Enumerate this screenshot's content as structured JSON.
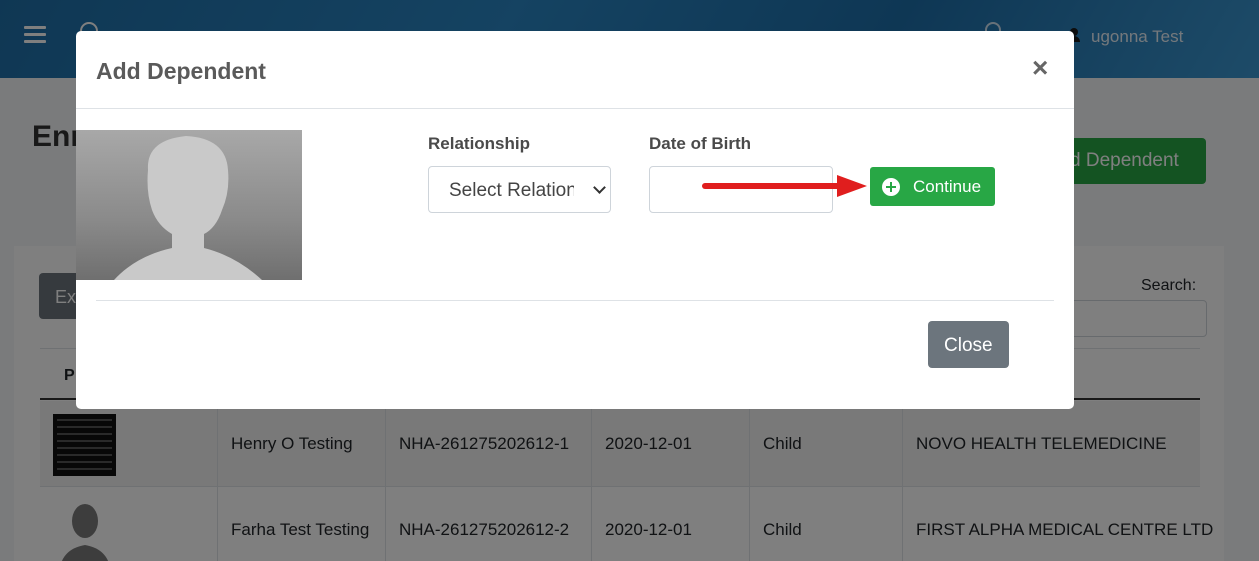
{
  "header": {
    "user_name": "ugonna Test"
  },
  "page": {
    "title": "Enr",
    "add_dependent_label": "d Dependent",
    "export_label": "Ex",
    "search_label": "Search:"
  },
  "table": {
    "first_header": "P",
    "rows": [
      {
        "name": "Henry O Testing",
        "id": "NHA-261275202612-1",
        "dob": "2020-12-01",
        "relationship": "Child",
        "provider": "NOVO HEALTH TELEMEDICINE"
      },
      {
        "name": "Farha Test Testing",
        "id": "NHA-261275202612-2",
        "dob": "2020-12-01",
        "relationship": "Child",
        "provider": "FIRST ALPHA MEDICAL CENTRE LTD"
      }
    ]
  },
  "modal": {
    "title": "Add Dependent",
    "close_x": "×",
    "relationship_label": "Relationship",
    "relationship_value": "Select Relationship",
    "dob_label": "Date of Birth",
    "dob_value": "",
    "continue_label": "Continue",
    "close_label": "Close"
  },
  "colors": {
    "primary_green": "#28a745",
    "secondary_gray": "#6c757d",
    "arrow_red": "#e01e1e",
    "header_blue": "#2a86c4"
  },
  "icons": [
    "menu-icon",
    "search-icon",
    "bell-icon",
    "user-icon",
    "close-icon",
    "chevron-down-icon",
    "plus-circle-icon"
  ]
}
